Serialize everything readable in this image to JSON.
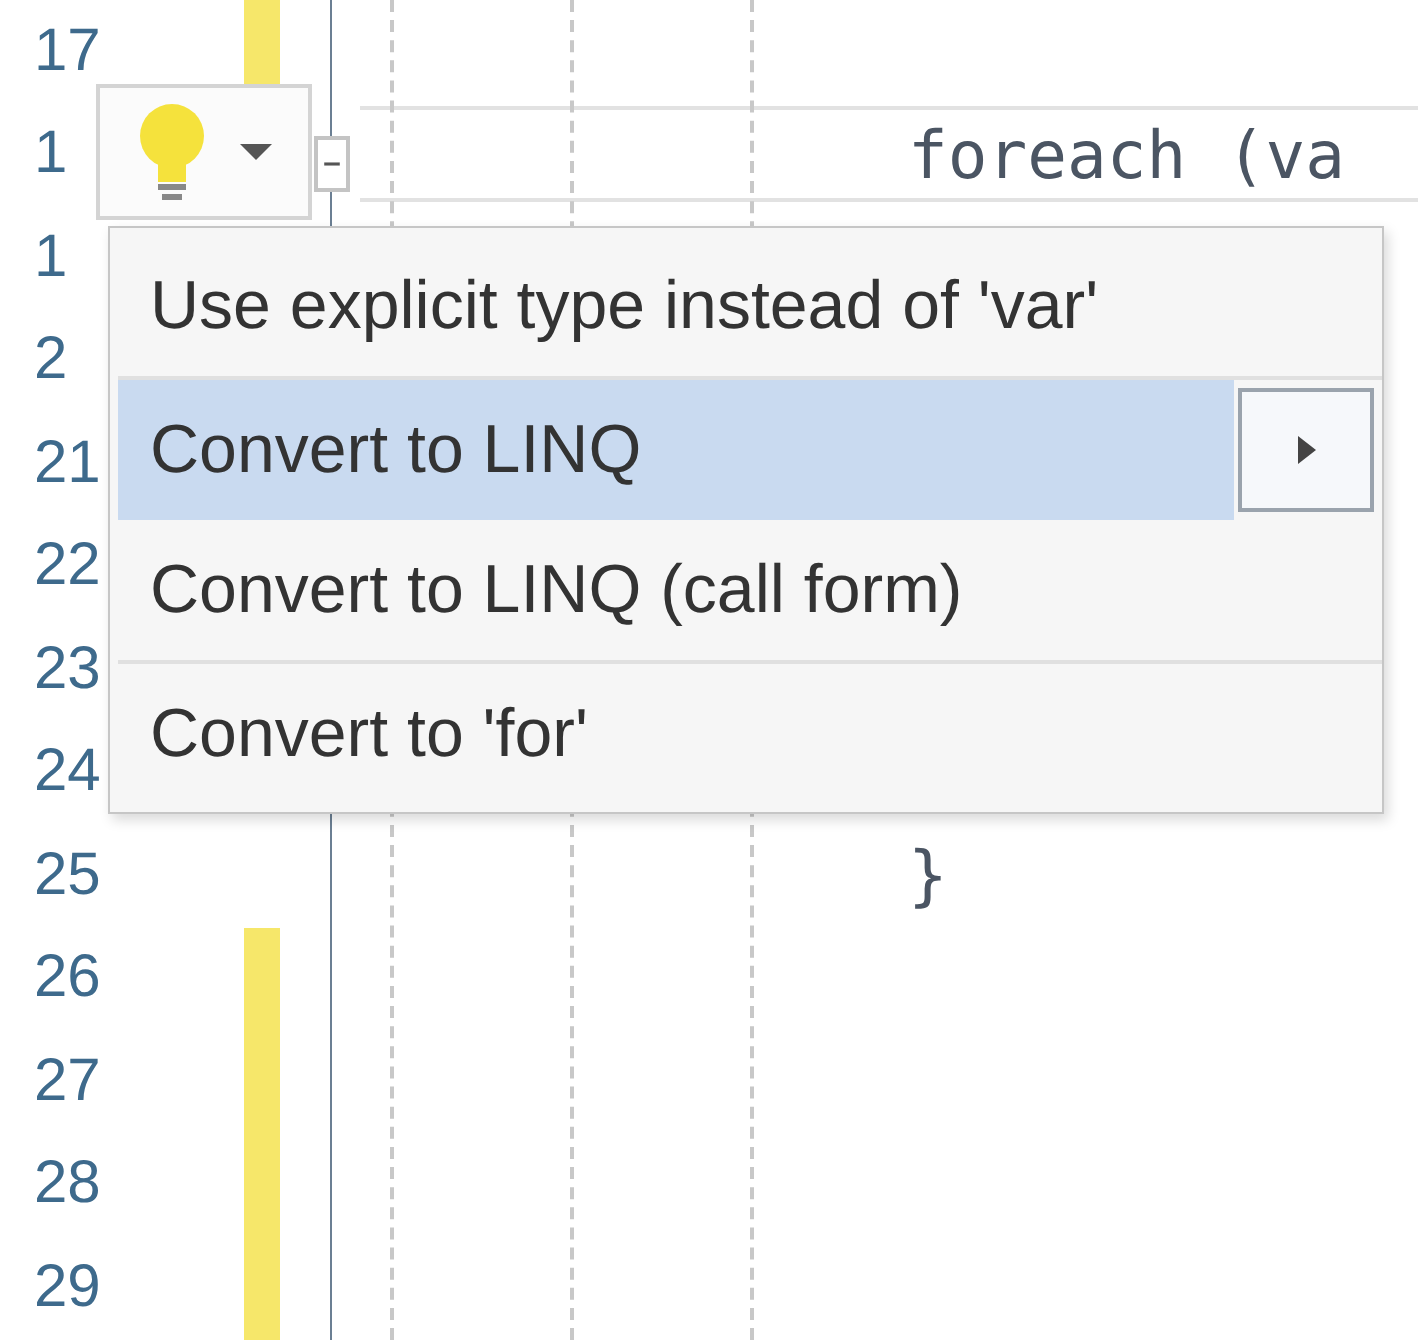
{
  "editor": {
    "lines": [
      {
        "number": "17",
        "changed": true
      },
      {
        "number": "1",
        "changed": false,
        "code": "foreach (va"
      },
      {
        "number": "1",
        "changed": false
      },
      {
        "number": "2",
        "changed": false
      },
      {
        "number": "21",
        "changed": false
      },
      {
        "number": "22",
        "changed": false
      },
      {
        "number": "23",
        "changed": false
      },
      {
        "number": "24",
        "changed": false
      },
      {
        "number": "25",
        "changed": false,
        "code": "}"
      },
      {
        "number": "26",
        "changed": true
      },
      {
        "number": "27",
        "changed": true
      },
      {
        "number": "28",
        "changed": true
      },
      {
        "number": "29",
        "changed": true
      }
    ]
  },
  "quick_actions": {
    "groups": [
      [
        {
          "label": "Use explicit type instead of 'var'",
          "selected": false,
          "has_submenu": false
        }
      ],
      [
        {
          "label": "Convert to LINQ",
          "selected": true,
          "has_submenu": true
        },
        {
          "label": "Convert to LINQ (call form)",
          "selected": false,
          "has_submenu": false
        }
      ],
      [
        {
          "label": "Convert to 'for'",
          "selected": false,
          "has_submenu": false
        }
      ]
    ]
  }
}
